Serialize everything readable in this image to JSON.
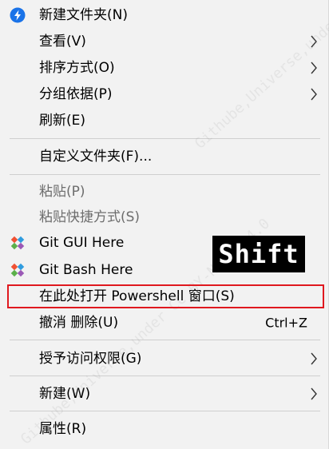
{
  "menu": {
    "items": [
      {
        "label": "新建文件夹(N)",
        "icon": "new-folder-icon"
      },
      {
        "label": "查看(V)"
      },
      {
        "label": "排序方式(O)"
      },
      {
        "label": "分组依据(P)"
      },
      {
        "label": "刷新(E)"
      },
      {
        "label": "自定义文件夹(F)..."
      },
      {
        "label": "粘贴(P)"
      },
      {
        "label": "粘贴快捷方式(S)"
      },
      {
        "label": "Git GUI Here",
        "icon": "git-icon"
      },
      {
        "label": "Git Bash Here",
        "icon": "git-icon"
      },
      {
        "label": "在此处打开 Powershell 窗口(S)"
      },
      {
        "label": "撤消 删除(U)",
        "shortcut": "Ctrl+Z"
      },
      {
        "label": "授予访问权限(G)"
      },
      {
        "label": "新建(W)"
      },
      {
        "label": "属性(R)"
      }
    ]
  },
  "overlay": {
    "shift_label": "Shift"
  },
  "watermark": {
    "text_upper": "Githube,Universe,under CC BY-NC-SA 4.0",
    "text_lower": "Githube,Universe,under CC BY-NC-SA 4.0"
  },
  "colors": {
    "menu_bg": "#f2f2f2",
    "disabled_text": "#6d6d6d",
    "highlight_border": "#e0191f",
    "blue_icon": "#1a73e8"
  }
}
